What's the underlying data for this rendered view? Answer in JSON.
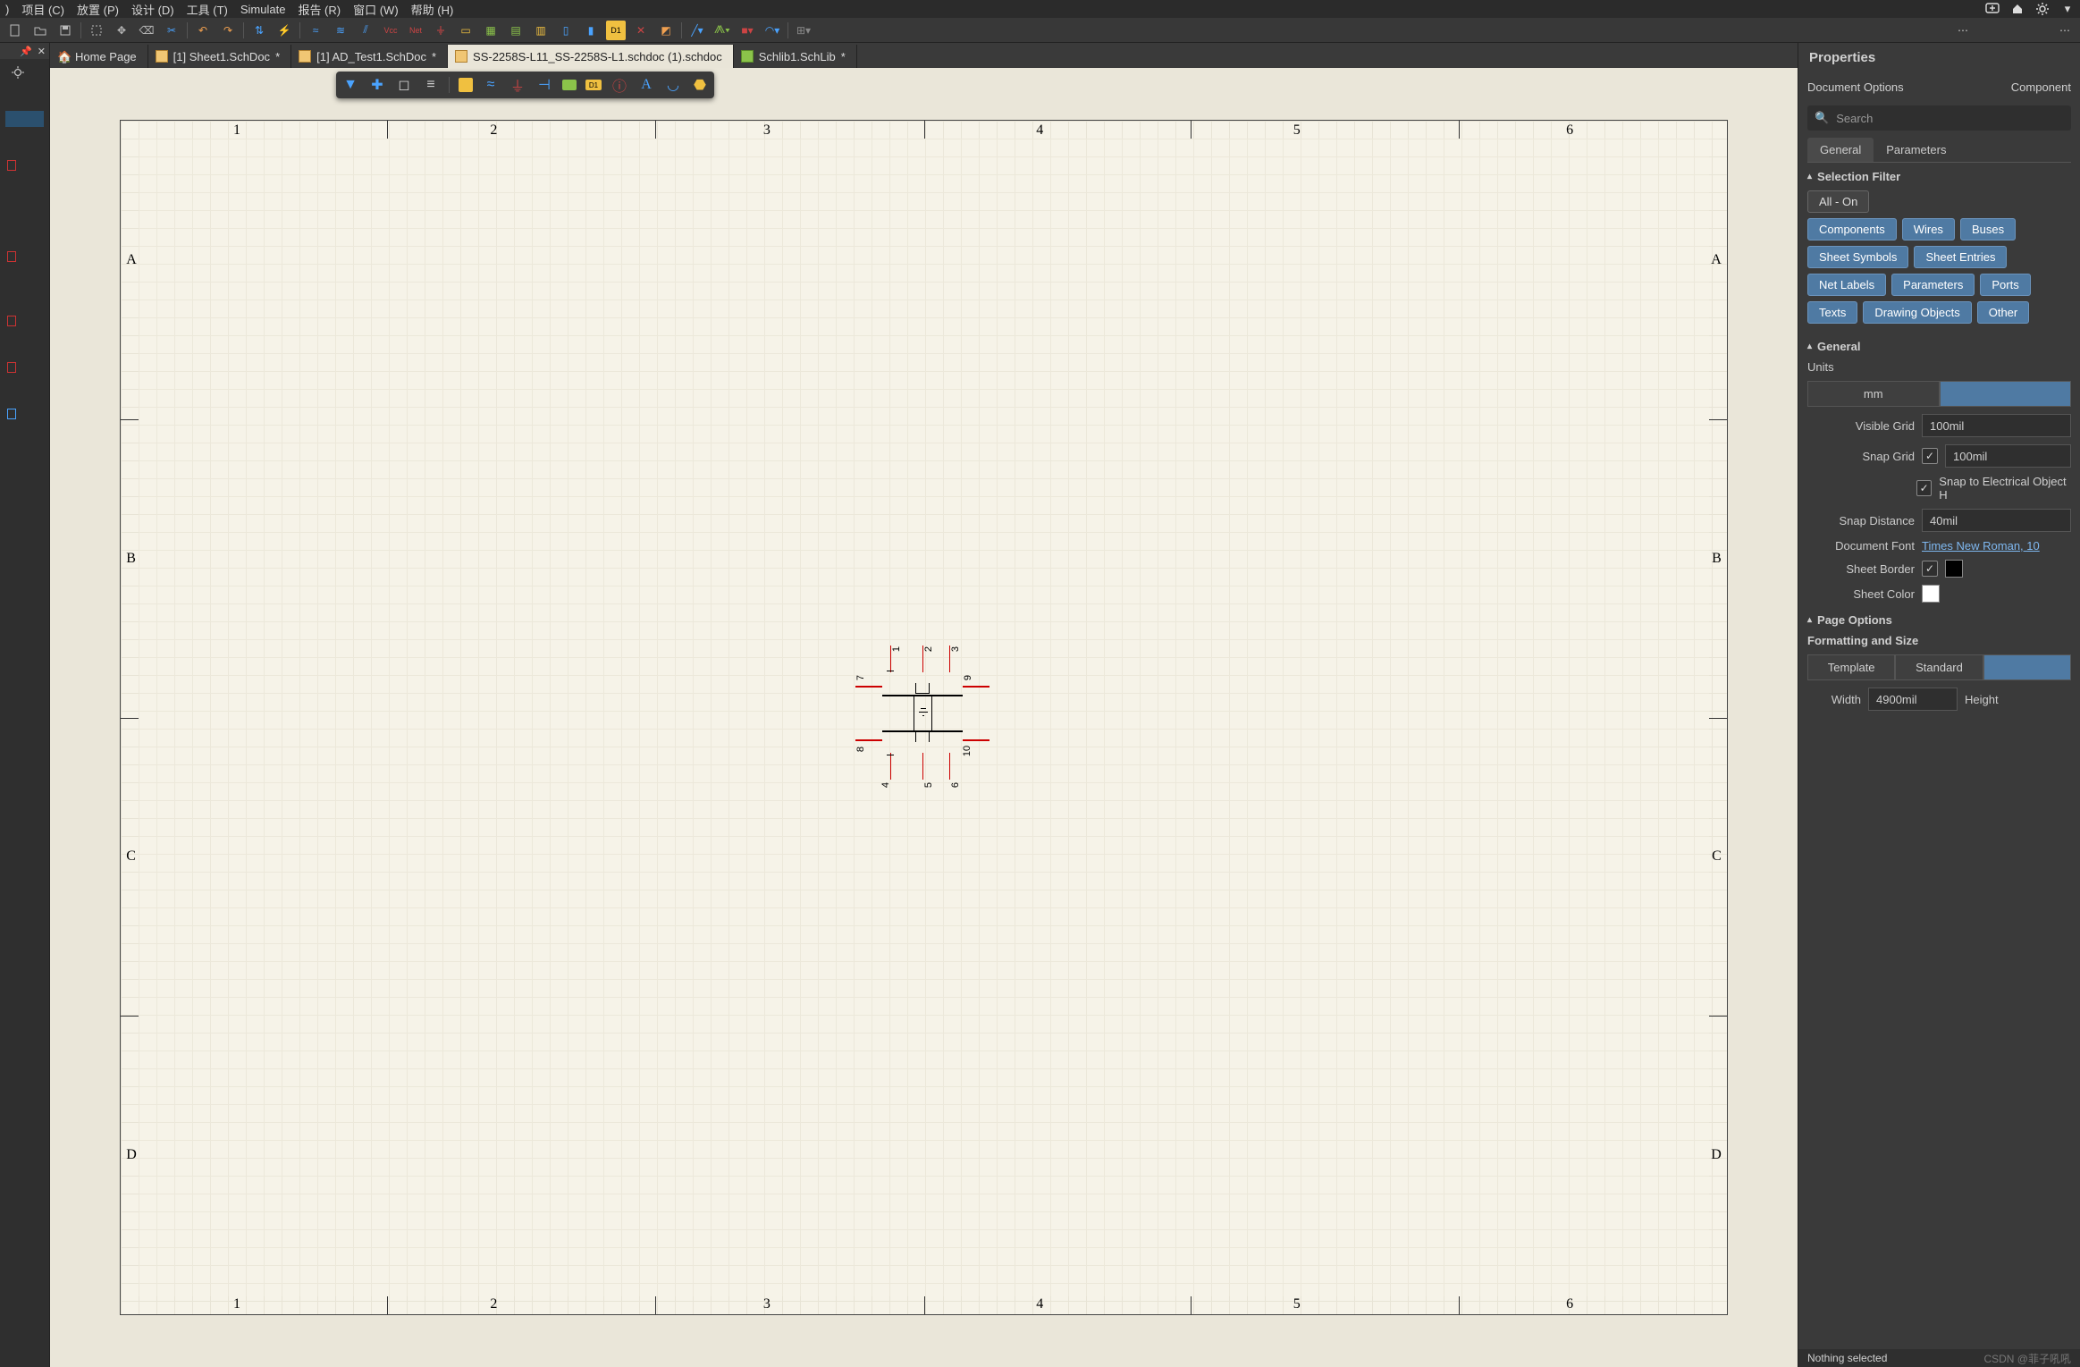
{
  "menu": {
    "items": [
      ")",
      "项目 (C)",
      "放置 (P)",
      "设计 (D)",
      "工具 (T)",
      "Simulate",
      "报告 (R)",
      "窗口 (W)",
      "帮助 (H)"
    ]
  },
  "toolbar": {
    "vcc_label": "Vcc",
    "net_label": "Net",
    "d1_label": "D1"
  },
  "tabs": [
    {
      "label": "Home Page",
      "kind": "home",
      "dirty": ""
    },
    {
      "label": "[1] Sheet1.SchDoc",
      "kind": "doc",
      "dirty": "*"
    },
    {
      "label": "[1] AD_Test1.SchDoc",
      "kind": "doc",
      "dirty": "*"
    },
    {
      "label": "SS-2258S-L11_SS-2258S-L1.schdoc (1).schdoc",
      "kind": "doc",
      "dirty": "",
      "active": true
    },
    {
      "label": "Schlib1.SchLib",
      "kind": "lib",
      "dirty": "*"
    }
  ],
  "sheet": {
    "cols": [
      "1",
      "2",
      "3",
      "4",
      "5",
      "6"
    ],
    "rows": [
      "A",
      "B",
      "C",
      "D"
    ]
  },
  "component": {
    "pins": [
      "1",
      "2",
      "3",
      "4",
      "5",
      "6",
      "7",
      "8",
      "9",
      "10"
    ]
  },
  "properties": {
    "title": "Properties",
    "context_left": "Document Options",
    "context_right": "Component",
    "search_placeholder": "Search",
    "tabs": {
      "general": "General",
      "parameters": "Parameters"
    },
    "selection_filter": {
      "title": "Selection Filter",
      "all": "All - On",
      "items": [
        "Components",
        "Wires",
        "Buses",
        "Sheet Symbols",
        "Sheet Entries",
        "Net Labels",
        "Parameters",
        "Ports",
        "Texts",
        "Drawing Objects",
        "Other"
      ]
    },
    "general": {
      "title": "General",
      "units_label": "Units",
      "unit_mm": "mm",
      "visible_grid_label": "Visible Grid",
      "visible_grid": "100mil",
      "snap_grid_label": "Snap Grid",
      "snap_grid": "100mil",
      "snap_elec": "Snap to Electrical Object H",
      "snap_dist_label": "Snap Distance",
      "snap_dist": "40mil",
      "doc_font_label": "Document Font",
      "doc_font": "Times New Roman, 10",
      "sheet_border_label": "Sheet Border",
      "sheet_color_label": "Sheet Color",
      "sheet_border_color": "#000000",
      "sheet_color": "#ffffff"
    },
    "page_options": {
      "title": "Page Options",
      "formatting": "Formatting and Size",
      "template": "Template",
      "standard": "Standard",
      "width_label": "Width",
      "width": "4900mil",
      "height_label": "Height"
    }
  },
  "status": {
    "left": "Nothing selected",
    "right": "CSDN @菲子吼吼"
  }
}
